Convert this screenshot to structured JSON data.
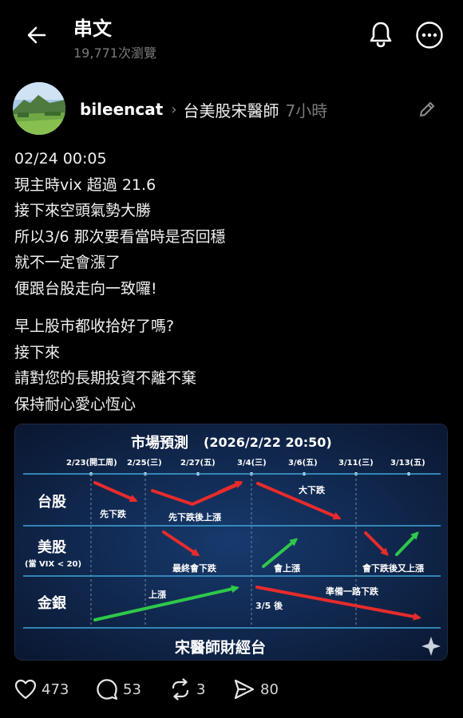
{
  "header": {
    "title": "串文",
    "views": "19,771次瀏覽"
  },
  "post": {
    "author": "bileencat",
    "channel": "台美股宋醫師",
    "time": "7小時",
    "lines_1": [
      "02/24  00:05",
      "現主時vix 超過 21.6",
      "接下來空頭氣勢大勝",
      "所以3/6 那次要看當時是否回穩",
      "就不一定會漲了",
      "便跟台股走向一致囉!"
    ],
    "lines_2": [
      "早上股市都收拾好了嗎?",
      "接下來",
      "請對您的長期投資不離不棄",
      "保持耐心愛心恆心"
    ]
  },
  "infographic": {
    "title": "市場預測",
    "datetime": "(2026/2/22 20:50)",
    "dates": [
      "2/23(開工周)",
      "2/25(三)",
      "2/27(五)",
      "3/4(三)",
      "3/6(五)",
      "3/11(三)",
      "3/13(五)"
    ],
    "rows": {
      "tw": {
        "label": "台股"
      },
      "us": {
        "label": "美股",
        "sub": "(當 VIX < 20)"
      },
      "gold": {
        "label": "金銀"
      }
    },
    "notes": {
      "tw1": "先下跌",
      "tw2": "先下跌後上漲",
      "tw3": "大下跌",
      "us1": "最終會下跌",
      "us2": "會上漲",
      "us3": "會下跌後又上漲",
      "g1": "上漲",
      "g2": "3/5 後",
      "g3": "準備一路下跌"
    },
    "footer": "宋醫師財經台",
    "colors": {
      "up": "#2ec84a",
      "down": "#e82b2b",
      "line": "#3fa6d8",
      "bg": "#0c1d3d"
    }
  },
  "actions": {
    "likes": "473",
    "comments": "53",
    "reposts": "3",
    "shares": "80"
  }
}
